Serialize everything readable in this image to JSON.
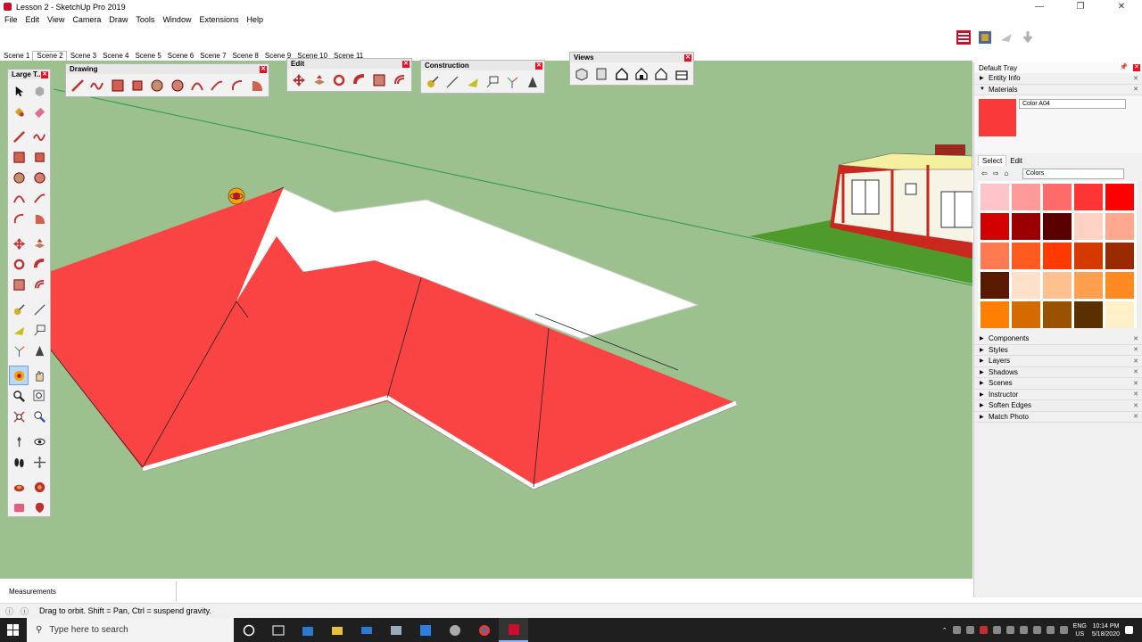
{
  "window": {
    "title": "Lesson 2 - SketchUp Pro 2019"
  },
  "menu": [
    "File",
    "Edit",
    "View",
    "Camera",
    "Draw",
    "Tools",
    "Window",
    "Extensions",
    "Help"
  ],
  "scenes": [
    "Scene 1",
    "Scene 2",
    "Scene 3",
    "Scene 4",
    "Scene 5",
    "Scene 6",
    "Scene 7",
    "Scene 8",
    "Scene 9",
    "Scene 10",
    "Scene 11"
  ],
  "active_scene": "Scene 2",
  "toolbars": {
    "large_tools": "Large T...",
    "drawing": "Drawing",
    "edit": "Edit",
    "construction": "Construction",
    "views": "Views"
  },
  "tray": {
    "title": "Default Tray",
    "panels_top": [
      "Entity Info",
      "Materials"
    ],
    "material_name": "Color A04",
    "material_color": "#fa3a3a",
    "tabs": [
      "Select",
      "Edit"
    ],
    "library": "Colors",
    "swatches": [
      "#ffc4c8",
      "#ff9a9a",
      "#ff6a6a",
      "#ff3434",
      "#ff0000",
      "#d40000",
      "#9a0000",
      "#5a0000",
      "#ffd2c4",
      "#ffa890",
      "#ff7a50",
      "#ff5a20",
      "#ff3a00",
      "#d43a00",
      "#9a2a00",
      "#5a1a00",
      "#ffe0c8",
      "#ffc090",
      "#ffa050",
      "#ff8a20",
      "#ff8000",
      "#d46a00",
      "#9a5200",
      "#5a3000",
      "#fff0c8"
    ],
    "panels_bottom": [
      "Components",
      "Styles",
      "Layers",
      "Shadows",
      "Scenes",
      "Instructor",
      "Soften Edges",
      "Match Photo"
    ]
  },
  "measurements_label": "Measurements",
  "status_text": "Drag to orbit. Shift = Pan, Ctrl = suspend gravity.",
  "taskbar": {
    "search_placeholder": "Type here to search",
    "lang_top": "ENG",
    "lang_bottom": "US",
    "time": "10:14 PM",
    "date": "5/18/2020"
  },
  "colors": {
    "roof": "#fa4444",
    "ground": "#9cc08e",
    "accent": "#c8102e"
  }
}
